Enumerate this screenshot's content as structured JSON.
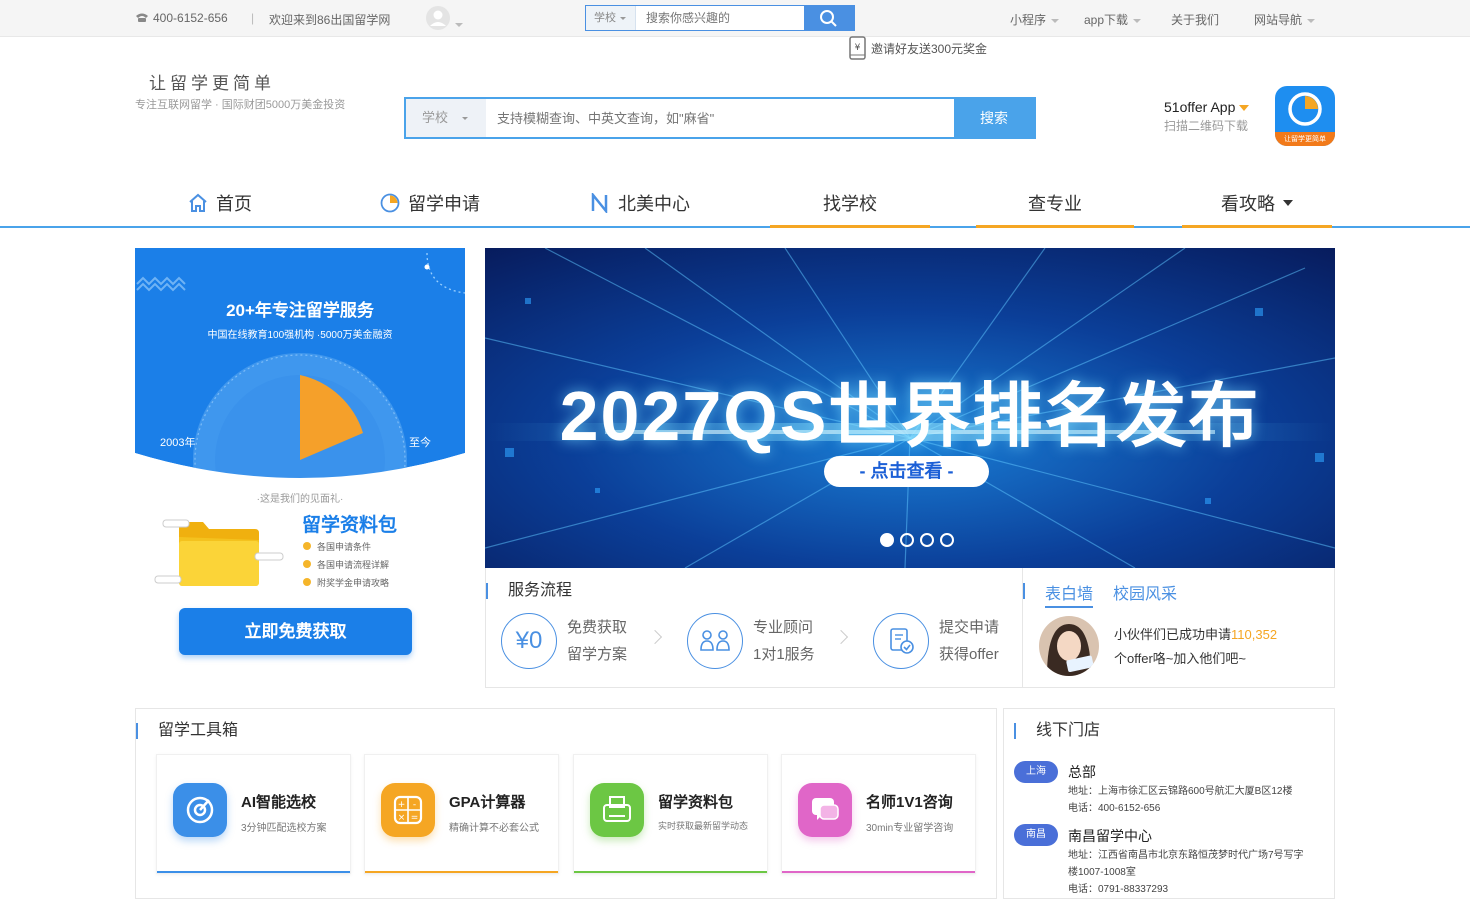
{
  "topbar": {
    "phone": "400-6152-656",
    "separator": "|",
    "welcome": "欢迎来到86出国留学网",
    "search_category": "学校",
    "search_placeholder": "搜索你感兴趣的",
    "links": [
      "小程序",
      "app下载",
      "关于我们",
      "网站导航"
    ],
    "invite": "邀请好友送300元奖金"
  },
  "header": {
    "slogan": "让留学更简单",
    "subtitle": "专注互联网留学 · 国际财团5000万美金投资",
    "search_category": "学校",
    "search_placeholder": "支持模糊查询、中英文查询，如\"麻省\"",
    "search_button": "搜索",
    "app_name": "51offer App",
    "app_desc": "扫描二维码下载",
    "app_icon_text": "让留学更简单"
  },
  "nav": {
    "items": [
      "首页",
      "留学申请",
      "北美中心",
      "找学校",
      "查专业",
      "看攻略"
    ]
  },
  "promo": {
    "headline": "20+年专注留学服务",
    "subline": "中国在线教育100强机构 ·5000万美金融资",
    "year_start": "2003年",
    "year_end": "至今",
    "gift_note": "·这是我们的见面礼·",
    "pack_title": "留学资料包",
    "pack_items": [
      "各国申请条件",
      "各国申请流程详解",
      "附奖学金申请攻略"
    ],
    "cta": "立即免费获取"
  },
  "banner": {
    "title": "2027QS世界排名发布",
    "button": "- 点击查看 -",
    "slides": 4,
    "active_slide": 1
  },
  "services": {
    "title": "服务流程",
    "steps": [
      {
        "icon": "¥0",
        "line1": "免费获取",
        "line2": "留学方案"
      },
      {
        "icon": "",
        "line1": "专业顾问",
        "line2": "1对1服务"
      },
      {
        "icon": "",
        "line1": "提交申请",
        "line2": "获得offer"
      }
    ]
  },
  "wall": {
    "tabs": [
      "表白墙",
      "校园风采"
    ],
    "text_prefix": "小伙伴们已成功申请",
    "count": "110,352",
    "text_line2": "个offer咯~加入他们吧~"
  },
  "tools": {
    "title": "留学工具箱",
    "items": [
      {
        "title": "AI智能选校",
        "desc": "3分钟匹配选校方案",
        "color": "#3b8fe8"
      },
      {
        "title": "GPA计算器",
        "desc": "精确计算不必套公式",
        "color": "#f5a623"
      },
      {
        "title": "留学资料包",
        "desc": "实时获取最新留学动态",
        "color": "#6cc744"
      },
      {
        "title": "名师1V1咨询",
        "desc": "30min专业留学咨询",
        "color": "#e066c8"
      }
    ]
  },
  "stores": {
    "title": "线下门店",
    "list": [
      {
        "city": "上海",
        "name": "总部",
        "address": "地址：上海市徐汇区云锦路600号航汇大厦B区12楼",
        "phone": "电话：400-6152-656"
      },
      {
        "city": "南昌",
        "name": "南昌留学中心",
        "address": "地址：江西省南昌市北京东路恒茂梦时代广场7号写字楼1007-1008室",
        "phone": "电话：0791-88337293"
      }
    ]
  },
  "colors": {
    "primary": "#4a90e2",
    "accent": "#f5a623",
    "promo_bg": "#1b7fe8"
  }
}
